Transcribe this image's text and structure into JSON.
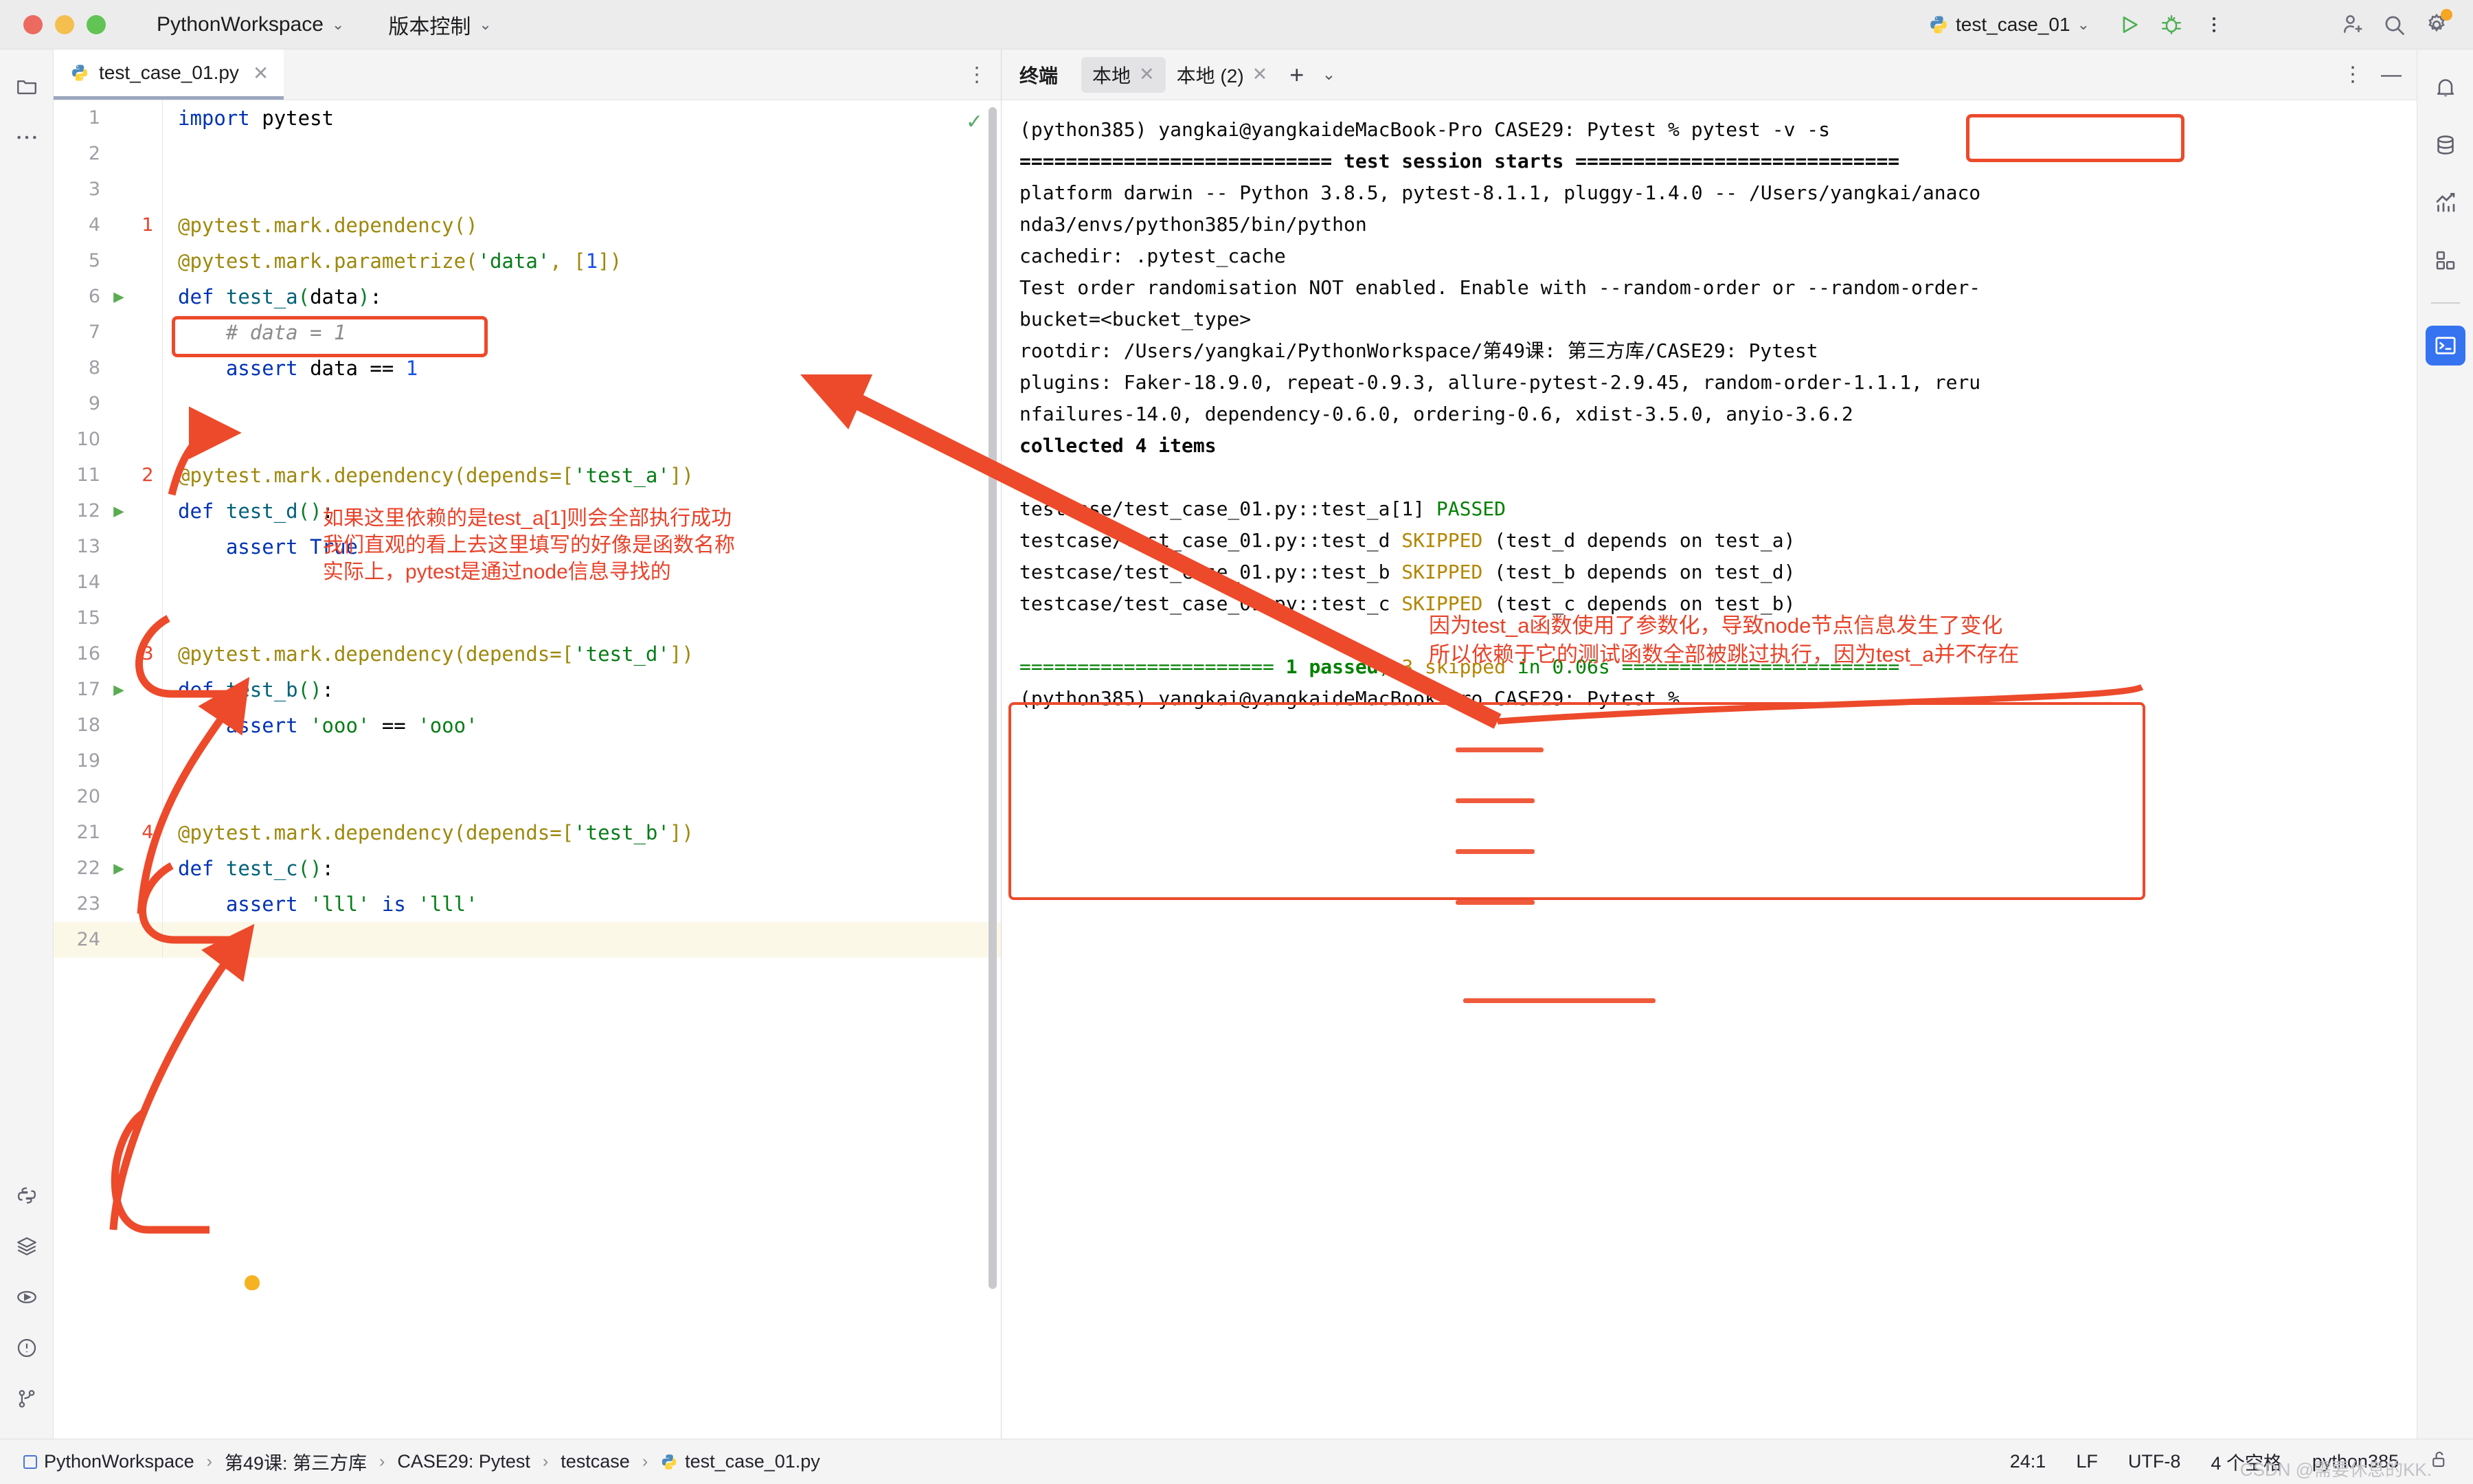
{
  "titlebar": {
    "project": "PythonWorkspace",
    "vcs": "版本控制",
    "run_config": "test_case_01",
    "icons": {
      "python": "python-logo-icon",
      "run": "run-icon",
      "debug": "debug-icon",
      "more": "more-vertical-icon",
      "add_user": "add-user-icon",
      "search": "search-icon",
      "settings": "settings-gear-icon"
    }
  },
  "leftbar": {
    "items": [
      {
        "name": "project-tool-icon",
        "glyph": "folder"
      },
      {
        "name": "more-tool-windows-icon",
        "glyph": "dots"
      },
      {
        "name": "python-console-icon",
        "glyph": "python"
      },
      {
        "name": "structure-icon",
        "glyph": "layers"
      },
      {
        "name": "run-tool-icon",
        "glyph": "play"
      },
      {
        "name": "problems-icon",
        "glyph": "warning"
      },
      {
        "name": "version-control-icon",
        "glyph": "git"
      }
    ]
  },
  "rightbar": {
    "items": [
      {
        "name": "notifications-icon"
      },
      {
        "name": "database-icon"
      },
      {
        "name": "profiler-icon"
      },
      {
        "name": "plugins-icon"
      },
      {
        "name": "terminal-icon",
        "active": true
      }
    ]
  },
  "editor": {
    "tab": {
      "filename": "test_case_01.py",
      "close": "✕",
      "icon": "python-file-icon"
    },
    "more": "⋮",
    "inspection_status": "✓",
    "lines": [
      {
        "n": 1,
        "mark": "",
        "run": false,
        "tokens": [
          [
            "k",
            "import"
          ],
          [
            "pl",
            " "
          ],
          [
            "id",
            "pytest"
          ]
        ]
      },
      {
        "n": 2,
        "mark": "",
        "run": false,
        "tokens": []
      },
      {
        "n": 3,
        "mark": "",
        "run": false,
        "tokens": []
      },
      {
        "n": 4,
        "mark": "1",
        "run": false,
        "tokens": [
          [
            "dec",
            "@pytest.mark.dependency()"
          ]
        ]
      },
      {
        "n": 5,
        "mark": "",
        "run": false,
        "tokens": [
          [
            "dec",
            "@pytest.mark.parametrize("
          ],
          [
            "str",
            "'data'"
          ],
          [
            "dec",
            ", ["
          ],
          [
            "num",
            "1"
          ],
          [
            "dec",
            "])"
          ]
        ]
      },
      {
        "n": 6,
        "mark": "",
        "run": true,
        "tokens": [
          [
            "k",
            "def"
          ],
          [
            "pl",
            " "
          ],
          [
            "fn",
            "test_a"
          ],
          [
            "pn",
            "("
          ],
          [
            "pl",
            "data"
          ],
          [
            "pn",
            ")"
          ],
          [
            "pl",
            ":"
          ]
        ]
      },
      {
        "n": 7,
        "mark": "",
        "run": false,
        "tokens": [
          [
            "cm",
            "    # data = 1"
          ]
        ]
      },
      {
        "n": 8,
        "mark": "",
        "run": false,
        "tokens": [
          [
            "pl",
            "    "
          ],
          [
            "k",
            "assert"
          ],
          [
            "pl",
            " data == "
          ],
          [
            "num",
            "1"
          ]
        ]
      },
      {
        "n": 9,
        "mark": "",
        "run": false,
        "tokens": []
      },
      {
        "n": 10,
        "mark": "",
        "run": false,
        "tokens": []
      },
      {
        "n": 11,
        "mark": "2",
        "run": false,
        "tokens": [
          [
            "dec",
            "@pytest.mark.dependency(depends=["
          ],
          [
            "str",
            "'test_a'"
          ],
          [
            "dec",
            "])"
          ]
        ]
      },
      {
        "n": 12,
        "mark": "",
        "run": true,
        "tokens": [
          [
            "k",
            "def"
          ],
          [
            "pl",
            " "
          ],
          [
            "fn",
            "test_d"
          ],
          [
            "pn",
            "()"
          ],
          [
            "pl",
            ":"
          ]
        ]
      },
      {
        "n": 13,
        "mark": "",
        "run": false,
        "tokens": [
          [
            "pl",
            "    "
          ],
          [
            "k",
            "assert True"
          ]
        ]
      },
      {
        "n": 14,
        "mark": "",
        "run": false,
        "tokens": []
      },
      {
        "n": 15,
        "mark": "",
        "run": false,
        "tokens": []
      },
      {
        "n": 16,
        "mark": "3",
        "run": false,
        "tokens": [
          [
            "dec",
            "@pytest.mark.dependency(depends=["
          ],
          [
            "str",
            "'test_d'"
          ],
          [
            "dec",
            "])"
          ]
        ]
      },
      {
        "n": 17,
        "mark": "",
        "run": true,
        "tokens": [
          [
            "k",
            "def"
          ],
          [
            "pl",
            " "
          ],
          [
            "fn",
            "test_b"
          ],
          [
            "pn",
            "()"
          ],
          [
            "pl",
            ":"
          ]
        ]
      },
      {
        "n": 18,
        "mark": "",
        "run": false,
        "tokens": [
          [
            "pl",
            "    "
          ],
          [
            "k",
            "assert"
          ],
          [
            "pl",
            " "
          ],
          [
            "str",
            "'ooo'"
          ],
          [
            "pl",
            " == "
          ],
          [
            "str",
            "'ooo'"
          ]
        ]
      },
      {
        "n": 19,
        "mark": "",
        "run": false,
        "tokens": []
      },
      {
        "n": 20,
        "mark": "",
        "run": false,
        "tokens": []
      },
      {
        "n": 21,
        "mark": "4",
        "run": false,
        "tokens": [
          [
            "dec",
            "@pytest.mark.dependency(depends=["
          ],
          [
            "str",
            "'test_b'"
          ],
          [
            "dec",
            "])"
          ]
        ]
      },
      {
        "n": 22,
        "mark": "",
        "run": true,
        "tokens": [
          [
            "k",
            "def"
          ],
          [
            "pl",
            " "
          ],
          [
            "fn",
            "test_c"
          ],
          [
            "pn",
            "()"
          ],
          [
            "pl",
            ":"
          ]
        ]
      },
      {
        "n": 23,
        "mark": "",
        "run": false,
        "tokens": [
          [
            "pl",
            "    "
          ],
          [
            "k",
            "assert"
          ],
          [
            "pl",
            " "
          ],
          [
            "str",
            "'lll'"
          ],
          [
            "pl",
            " "
          ],
          [
            "k",
            "is"
          ],
          [
            "pl",
            " "
          ],
          [
            "str",
            "'lll'"
          ]
        ]
      },
      {
        "n": 24,
        "mark": "",
        "run": false,
        "current": true,
        "tokens": []
      }
    ]
  },
  "terminal": {
    "title": "终端",
    "tabs": [
      {
        "label": "本地",
        "active": true,
        "close": "✕"
      },
      {
        "label": "本地 (2)",
        "active": false,
        "close": "✕"
      }
    ],
    "add": "+",
    "dropdown": "⌄",
    "more": "⋮",
    "minimize": "—",
    "lines": [
      {
        "segs": [
          [
            "plain",
            "(python385) yangkai@yangkaideMacBook-Pro CASE29: Pytest % "
          ],
          [
            "plain",
            "pytest -v -s"
          ]
        ]
      },
      {
        "segs": [
          [
            "bold",
            "=========================== test session starts ============================"
          ]
        ]
      },
      {
        "segs": [
          [
            "plain",
            "platform darwin -- Python 3.8.5, pytest-8.1.1, pluggy-1.4.0 -- /Users/yangkai/anaco"
          ]
        ]
      },
      {
        "segs": [
          [
            "plain",
            "nda3/envs/python385/bin/python"
          ]
        ]
      },
      {
        "segs": [
          [
            "plain",
            "cachedir: .pytest_cache"
          ]
        ]
      },
      {
        "segs": [
          [
            "plain",
            "Test order randomisation NOT enabled. Enable with --random-order or --random-order-"
          ]
        ]
      },
      {
        "segs": [
          [
            "plain",
            "bucket=<bucket_type>"
          ]
        ]
      },
      {
        "segs": [
          [
            "plain",
            "rootdir: /Users/yangkai/PythonWorkspace/第49课: 第三方库/CASE29: Pytest"
          ]
        ]
      },
      {
        "segs": [
          [
            "plain",
            "plugins: Faker-18.9.0, repeat-0.9.3, allure-pytest-2.9.45, random-order-1.1.1, reru"
          ]
        ]
      },
      {
        "segs": [
          [
            "plain",
            "nfailures-14.0, dependency-0.6.0, ordering-0.6, xdist-3.5.0, anyio-3.6.2"
          ]
        ]
      },
      {
        "segs": [
          [
            "bold",
            "collected 4 items"
          ]
        ]
      },
      {
        "segs": []
      },
      {
        "segs": [
          [
            "plain",
            "testcase/test_case_01.py::test_a[1] "
          ],
          [
            "green",
            "PASSED"
          ]
        ]
      },
      {
        "segs": [
          [
            "plain",
            "testcase/test_case_01.py::test_d "
          ],
          [
            "yellow",
            "SKIPPED"
          ],
          [
            "plain",
            " (test_d depends on test_a)"
          ]
        ]
      },
      {
        "segs": [
          [
            "plain",
            "testcase/test_case_01.py::test_b "
          ],
          [
            "yellow",
            "SKIPPED"
          ],
          [
            "plain",
            " (test_b depends on test_d)"
          ]
        ]
      },
      {
        "segs": [
          [
            "plain",
            "testcase/test_case_01.py::test_c "
          ],
          [
            "yellow",
            "SKIPPED"
          ],
          [
            "plain",
            " (test_c depends on test_b)"
          ]
        ]
      },
      {
        "segs": []
      },
      {
        "segs": [
          [
            "green",
            "====================== "
          ],
          [
            "greenbold",
            "1 passed"
          ],
          [
            "green",
            ", "
          ],
          [
            "yellow",
            "3 skipped"
          ],
          [
            "green",
            " in 0.06s ========================"
          ]
        ]
      },
      {
        "segs": [
          [
            "plain",
            "(python385) yangkai@yangkaideMacBook-Pro CASE29: Pytest %"
          ]
        ]
      }
    ]
  },
  "statusbar": {
    "breadcrumb": [
      "PythonWorkspace",
      "第49课: 第三方库",
      "CASE29: Pytest",
      "testcase",
      "test_case_01.py"
    ],
    "separator": "›",
    "caret": "24:1",
    "line_ending": "LF",
    "encoding": "UTF-8",
    "indent": "4 个空格",
    "interpreter": "python385",
    "lock_icon": "unlocked-icon"
  },
  "annotations": {
    "editor_note": "如果这里依赖的是test_a[1]则会全部执行成功\n我们直观的看上去这里填写的好像是函数名称\n实际上，pytest是通过node信息寻找的",
    "terminal_note": "因为test_a函数使用了参数化，导致node节点信息发生了变化\n所以依赖于它的测试函数全部被跳过执行，因为test_a并不存在",
    "accent_color": "#ec4a2b"
  },
  "watermark": "CSDN @需要休息的KK."
}
